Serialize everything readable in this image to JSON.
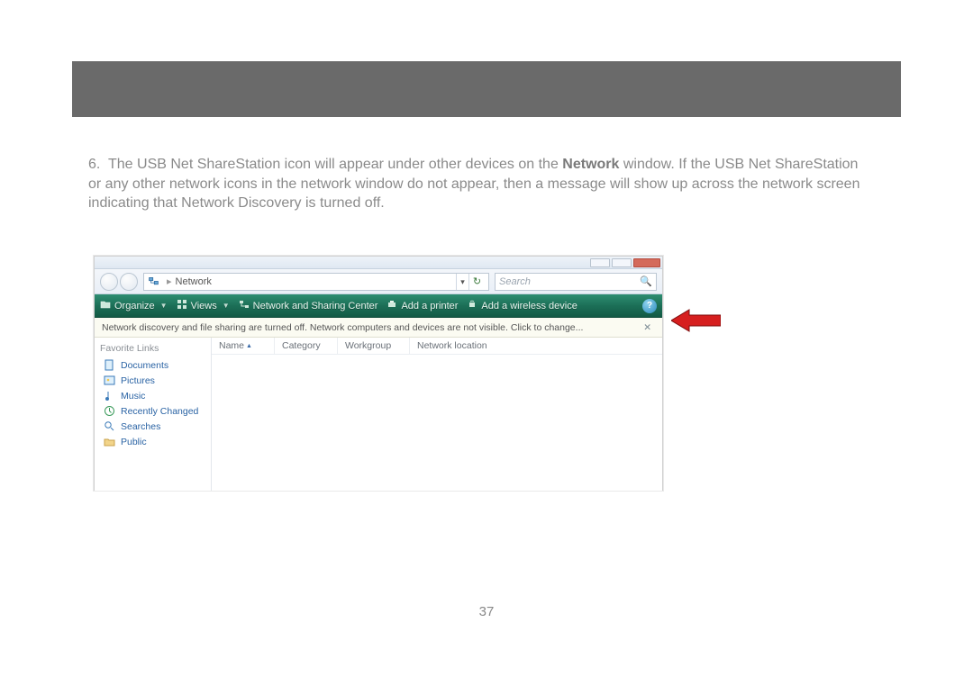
{
  "step_number": "6.",
  "step_text_before_bold": "The USB Net ShareStation icon will appear under other devices on the ",
  "step_bold": "Network",
  "step_text_after_bold": " window. If the USB Net ShareStation or any other network icons in the network window do not appear, then a message will show up across the network screen indicating that Network Discovery is turned off.",
  "page_number": "37",
  "window": {
    "breadcrumb_sep": "▸",
    "breadcrumb_location": "Network",
    "search_placeholder": "Search",
    "toolbar": {
      "organize": "Organize",
      "views": "Views",
      "sharing_center": "Network and Sharing Center",
      "add_printer": "Add a printer",
      "add_wireless": "Add a wireless device"
    },
    "infobar_text": "Network discovery and file sharing are turned off. Network computers and devices are not visible. Click to change...",
    "sidebar": {
      "heading": "Favorite Links",
      "items": [
        {
          "label": "Documents"
        },
        {
          "label": "Pictures"
        },
        {
          "label": "Music"
        },
        {
          "label": "Recently Changed"
        },
        {
          "label": "Searches"
        },
        {
          "label": "Public"
        }
      ]
    },
    "columns": {
      "name": "Name",
      "category": "Category",
      "workgroup": "Workgroup",
      "location": "Network location"
    }
  }
}
